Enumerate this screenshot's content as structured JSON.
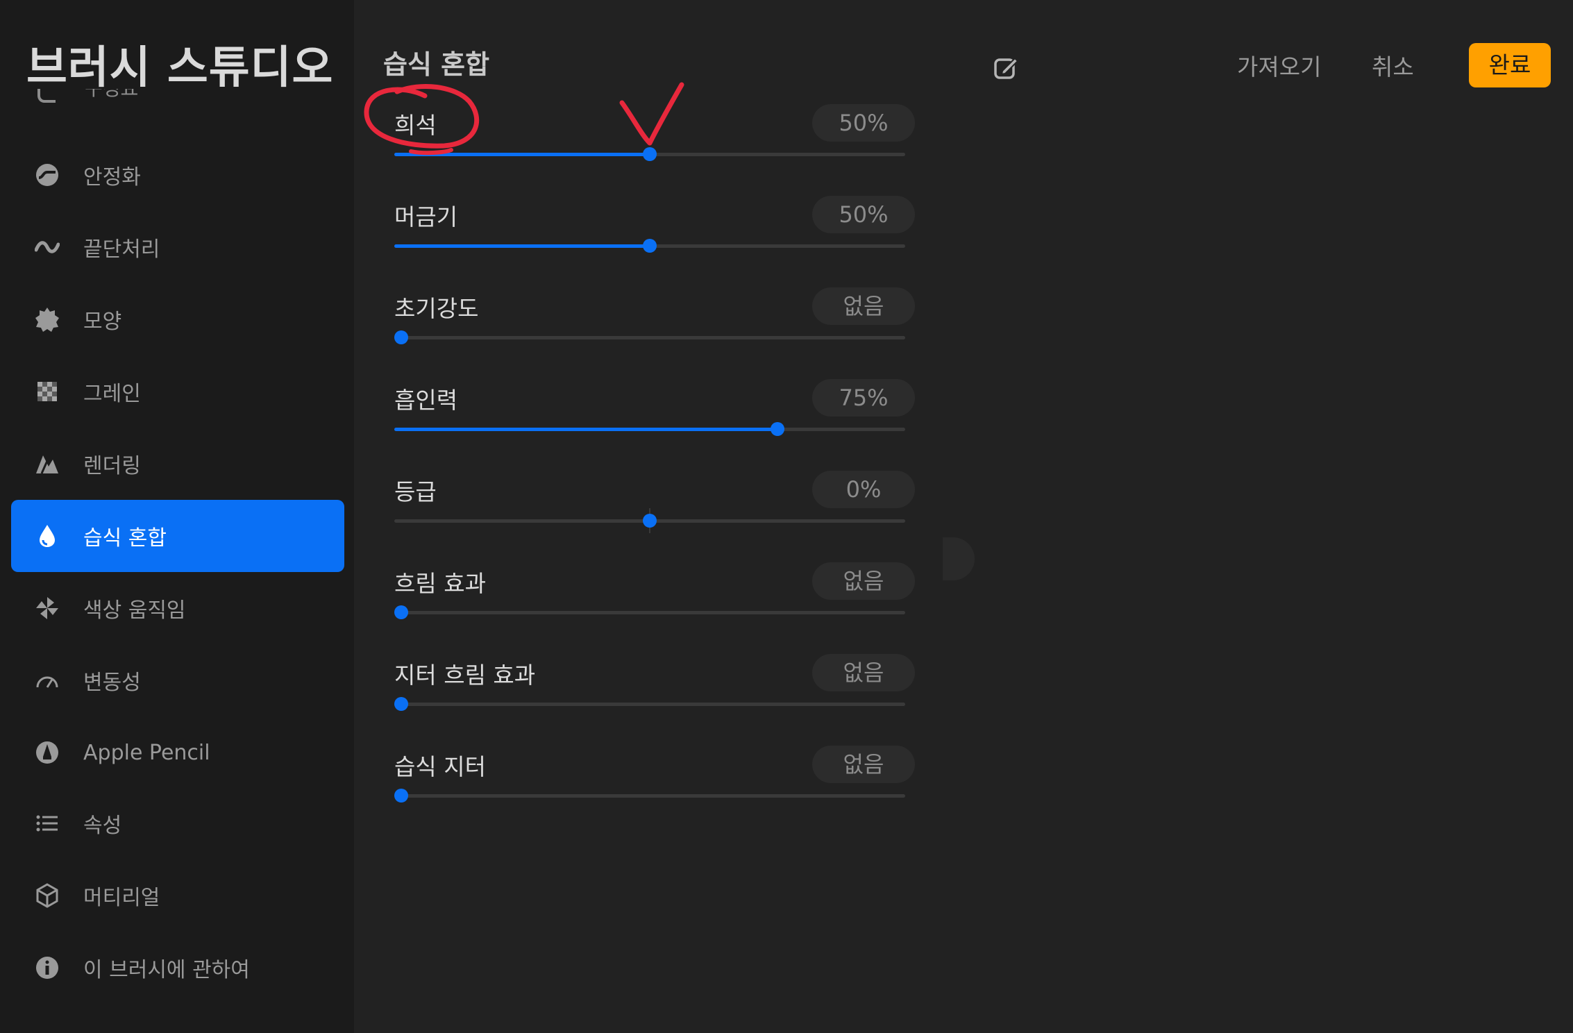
{
  "app": {
    "title": "브러시 스튜디오"
  },
  "sidebar": {
    "partial_item_label": "구성요",
    "items": [
      {
        "label": "안정화",
        "icon": "stabilization-icon",
        "active": false
      },
      {
        "label": "끝단처리",
        "icon": "taper-wave-icon",
        "active": false
      },
      {
        "label": "모양",
        "icon": "shape-badge-icon",
        "active": false
      },
      {
        "label": "그레인",
        "icon": "grain-checker-icon",
        "active": false
      },
      {
        "label": "렌더링",
        "icon": "rendering-icon",
        "active": false
      },
      {
        "label": "습식 혼합",
        "icon": "water-drop-icon",
        "active": true
      },
      {
        "label": "색상 움직임",
        "icon": "pinwheel-icon",
        "active": false
      },
      {
        "label": "변동성",
        "icon": "gauge-icon",
        "active": false
      },
      {
        "label": "Apple Pencil",
        "icon": "pencil-tip-icon",
        "active": false
      },
      {
        "label": "속성",
        "icon": "list-icon",
        "active": false
      },
      {
        "label": "머티리얼",
        "icon": "cube-icon",
        "active": false
      },
      {
        "label": "이 브러시에 관하여",
        "icon": "info-icon",
        "active": false
      }
    ]
  },
  "panel": {
    "title": "습식 혼합",
    "settings": [
      {
        "label": "희석",
        "value": "50%",
        "fraction": 0.5,
        "centered": false
      },
      {
        "label": "머금기",
        "value": "50%",
        "fraction": 0.5,
        "centered": false
      },
      {
        "label": "초기강도",
        "value": "없음",
        "fraction": 0.0,
        "centered": false
      },
      {
        "label": "흡인력",
        "value": "75%",
        "fraction": 0.75,
        "centered": false
      },
      {
        "label": "등급",
        "value": "0%",
        "fraction": 0.5,
        "centered": true
      },
      {
        "label": "흐림 효과",
        "value": "없음",
        "fraction": 0.0,
        "centered": false
      },
      {
        "label": "지터 흐림 효과",
        "value": "없음",
        "fraction": 0.0,
        "centered": false
      },
      {
        "label": "습식 지터",
        "value": "없음",
        "fraction": 0.0,
        "centered": false
      }
    ]
  },
  "toolbar": {
    "edit_icon": "edit-square-icon",
    "import_label": "가져오기",
    "cancel_label": "취소",
    "done_label": "완료"
  },
  "colors": {
    "accent": "#0a70f5",
    "done_button": "#ffa000",
    "annotation": "#e8283c"
  }
}
